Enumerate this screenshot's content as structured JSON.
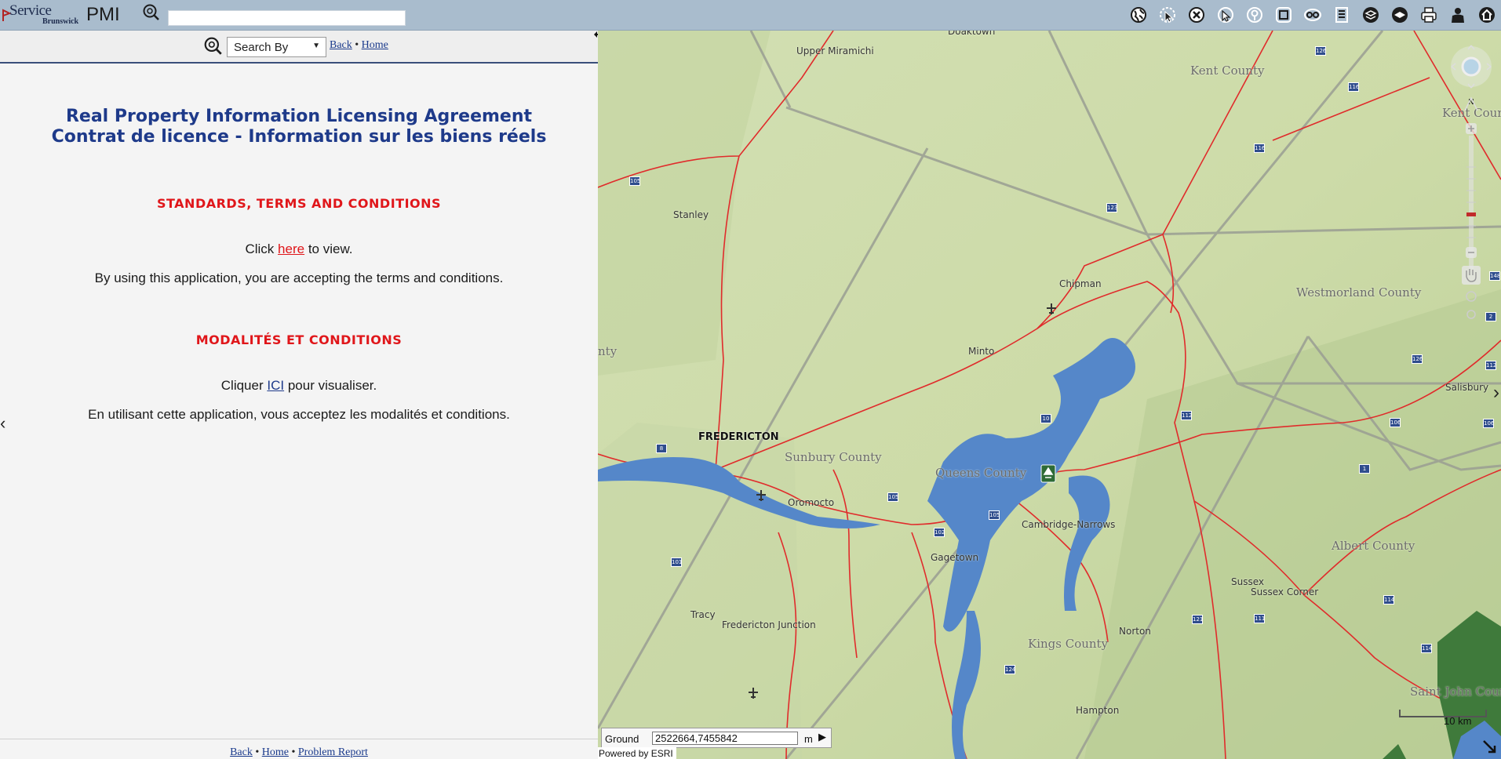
{
  "header": {
    "logo_line1": "Service",
    "logo_line2": "Brunswick",
    "app_title": "PMI",
    "search_value": "",
    "tools": [
      {
        "name": "globe-icon"
      },
      {
        "name": "identify-cursor-icon"
      },
      {
        "name": "clear-icon"
      },
      {
        "name": "select-cursor-icon"
      },
      {
        "name": "info-icon"
      },
      {
        "name": "extent-icon"
      },
      {
        "name": "overview-icon"
      },
      {
        "name": "legend-icon"
      },
      {
        "name": "layers-icon"
      },
      {
        "name": "basemap-icon"
      },
      {
        "name": "print-icon"
      },
      {
        "name": "user-icon"
      },
      {
        "name": "home-icon"
      }
    ]
  },
  "panel": {
    "search_by_label": "Search By",
    "back_link": "Back",
    "home_link": "Home",
    "separator": "•",
    "title_en": "Real Property Information Licensing Agreement",
    "title_fr": "Contrat de licence - Information sur les biens réels",
    "heading_en": "STANDARDS, TERMS AND CONDITIONS",
    "click_prefix": "Click",
    "click_link": "here",
    "click_suffix": "to view.",
    "accept_en": "By using this application, you are accepting the terms and conditions.",
    "heading_fr": "MODALITÉS ET CONDITIONS",
    "cliquer_prefix": "Cliquer",
    "cliquer_link": "ICI",
    "cliquer_suffix": "pour visualiser.",
    "accept_fr": "En utilisant cette application, vous acceptez les modalités et conditions.",
    "footer_back": "Back",
    "footer_home": "Home",
    "footer_problem": "Problem Report"
  },
  "map": {
    "places": [
      "Upper Miramichi",
      "Stanley",
      "Chipman",
      "Minto",
      "Oromocto",
      "Gagetown",
      "Cambridge-Narrows",
      "Tracy",
      "Fredericton Junction",
      "Norton",
      "Sussex",
      "Sussex Corner",
      "Hampton",
      "Salisbury",
      "Doaktown"
    ],
    "counties": [
      "Kent County",
      "Westmorland County",
      "Sunbury County",
      "Queens County",
      "Albert County",
      "Kings County",
      "Kent Coun",
      "Saint John Count",
      "nty"
    ],
    "city": "FREDERICTON",
    "highways": [
      "126",
      "116",
      "116",
      "123",
      "105",
      "148",
      "10",
      "126",
      "112",
      "112",
      "8",
      "105",
      "102",
      "101",
      "1",
      "106",
      "114",
      "114",
      "121",
      "111",
      "124",
      "105",
      "2",
      "106"
    ],
    "coord_label": "Ground",
    "coord_value": "2522664,7455842",
    "coord_unit": "m",
    "powered_by": "Powered by ESRI",
    "scale_label": "10 km",
    "zoom_label": "N"
  }
}
